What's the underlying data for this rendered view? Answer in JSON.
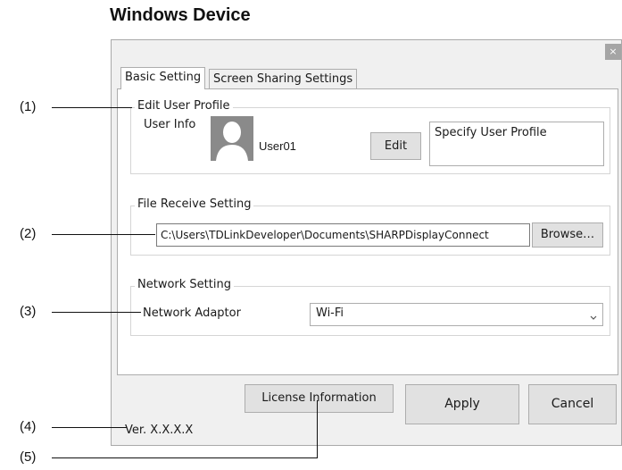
{
  "heading": "Windows Device",
  "window": {
    "close_glyph": "×"
  },
  "tabs": [
    {
      "label": "Basic Setting",
      "active": true
    },
    {
      "label": "Screen Sharing Settings",
      "active": false
    }
  ],
  "edit_user_profile": {
    "title": "Edit User Profile",
    "user_info_label": "User Info",
    "user_name": "User01",
    "edit_button": "Edit",
    "specify_text": "Specify User Profile",
    "avatar_icon": "user-silhouette-icon"
  },
  "file_receive": {
    "title": "File Receive Setting",
    "path": "C:\\Users\\TDLinkDeveloper\\Documents\\SHARPDisplayConnect",
    "browse_button": "Browse…"
  },
  "network": {
    "title": "Network Setting",
    "adaptor_label": "Network Adaptor",
    "adaptor_value": "Wi-Fi",
    "dropdown_icon": "chevron-down-icon"
  },
  "footer": {
    "license_button": "License Information",
    "apply_button": "Apply",
    "cancel_button": "Cancel",
    "version": "Ver. X.X.X.X"
  },
  "callouts": [
    "(1)",
    "(2)",
    "(3)",
    "(4)",
    "(5)"
  ]
}
